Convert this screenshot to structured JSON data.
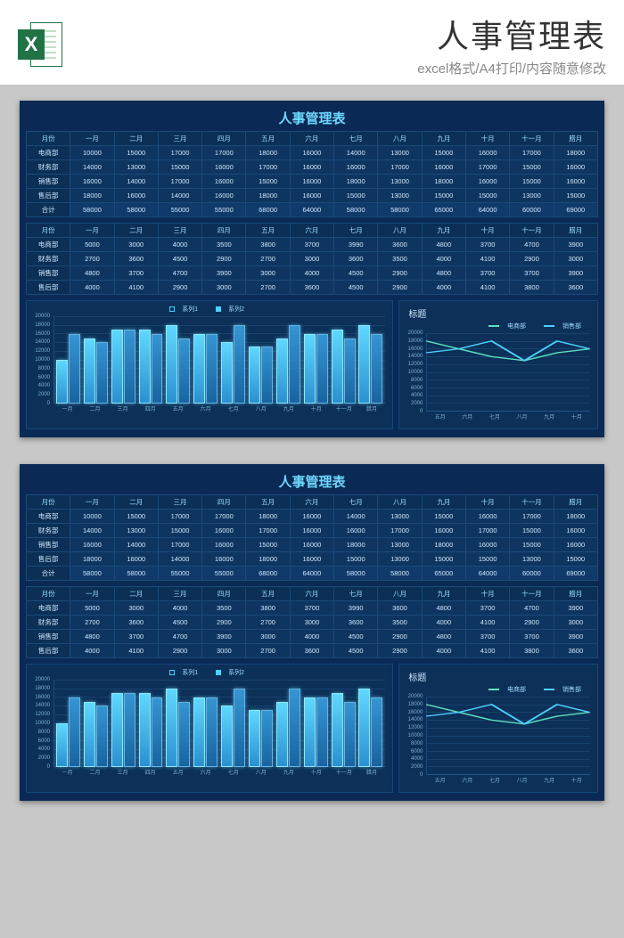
{
  "header": {
    "title": "人事管理表",
    "subtitle": "excel格式/A4打印/内容随意修改",
    "icon_letter": "X"
  },
  "sheet": {
    "title": "人事管理表",
    "months": [
      "一月",
      "二月",
      "三月",
      "四月",
      "五月",
      "六月",
      "七月",
      "八月",
      "九月",
      "十月",
      "十一月",
      "腊月"
    ],
    "month_header": "月份",
    "table1_rows": [
      {
        "label": "电商部",
        "v": [
          10000,
          15000,
          17000,
          17000,
          18000,
          16000,
          14000,
          13000,
          15000,
          16000,
          17000,
          18000
        ]
      },
      {
        "label": "财务部",
        "v": [
          14000,
          13000,
          15000,
          16000,
          17000,
          16000,
          16000,
          17000,
          16000,
          17000,
          15000,
          16000
        ]
      },
      {
        "label": "销售部",
        "v": [
          16000,
          14000,
          17000,
          16000,
          15000,
          16000,
          18000,
          13000,
          18000,
          16000,
          15000,
          16000
        ]
      },
      {
        "label": "售后部",
        "v": [
          18000,
          16000,
          14000,
          16000,
          18000,
          16000,
          15000,
          13000,
          15000,
          15000,
          13000,
          15000
        ]
      }
    ],
    "table1_total": {
      "label": "合计",
      "v": [
        58000,
        58000,
        55000,
        55000,
        68000,
        64000,
        58000,
        58000,
        65000,
        64000,
        60000,
        69000
      ]
    },
    "table2_rows": [
      {
        "label": "电商部",
        "v": [
          5000,
          3000,
          4000,
          3500,
          3800,
          3700,
          3990,
          3600,
          4800,
          3700,
          4700,
          3900
        ]
      },
      {
        "label": "财务部",
        "v": [
          2700,
          3600,
          4500,
          2900,
          2700,
          3000,
          3600,
          3500,
          4000,
          4100,
          2900,
          3000
        ]
      },
      {
        "label": "销售部",
        "v": [
          4800,
          3700,
          4700,
          3900,
          3000,
          4000,
          4500,
          2900,
          4800,
          3700,
          3700,
          3900
        ]
      },
      {
        "label": "售后部",
        "v": [
          4000,
          4100,
          2900,
          3000,
          2700,
          3600,
          4500,
          2900,
          4000,
          4100,
          3800,
          3600
        ]
      }
    ]
  },
  "chart_data": [
    {
      "type": "bar",
      "title": "",
      "legend": [
        "系列1",
        "系列2"
      ],
      "categories": [
        "一月",
        "二月",
        "三月",
        "四月",
        "五月",
        "六月",
        "七月",
        "八月",
        "九月",
        "十月",
        "十一月",
        "腊月"
      ],
      "series": [
        {
          "name": "系列1",
          "values": [
            10000,
            15000,
            17000,
            17000,
            18000,
            16000,
            14000,
            13000,
            15000,
            16000,
            17000,
            18000
          ]
        },
        {
          "name": "系列2",
          "values": [
            16000,
            14000,
            17000,
            16000,
            15000,
            16000,
            18000,
            13000,
            18000,
            16000,
            15000,
            16000
          ]
        }
      ],
      "ylim": [
        0,
        20000
      ],
      "yticks": [
        0,
        2000,
        4000,
        6000,
        8000,
        10000,
        12000,
        14000,
        16000,
        18000,
        20000
      ]
    },
    {
      "type": "line",
      "title": "标题",
      "legend": [
        "电商部",
        "销售部"
      ],
      "categories": [
        "五月",
        "六月",
        "七月",
        "八月",
        "九月",
        "十月"
      ],
      "series": [
        {
          "name": "电商部",
          "values": [
            18000,
            16000,
            14000,
            13000,
            15000,
            16000
          ]
        },
        {
          "name": "销售部",
          "values": [
            15000,
            16000,
            18000,
            13000,
            18000,
            16000
          ]
        }
      ],
      "ylim": [
        0,
        20000
      ],
      "yticks": [
        0,
        2000,
        4000,
        6000,
        8000,
        10000,
        12000,
        14000,
        16000,
        18000,
        20000
      ]
    }
  ]
}
